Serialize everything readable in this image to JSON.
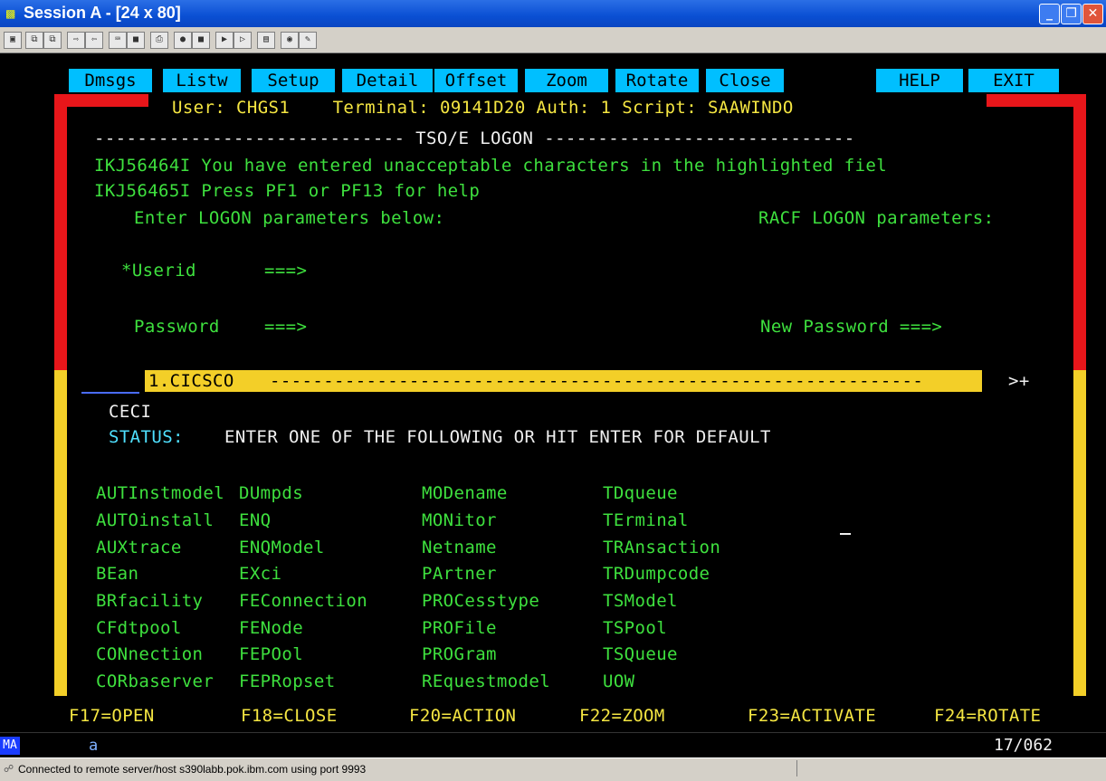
{
  "window": {
    "title": "Session A - [24 x 80]"
  },
  "menu": [
    "Dmsgs",
    "Listw",
    "Setup",
    "Detail",
    "Offset",
    "Zoom",
    "Rotate",
    "Close",
    "HELP",
    "EXIT"
  ],
  "header_line": "User: CHGS1    Terminal: 09141D20 Auth: 1 Script: SAAWINDO",
  "logon": {
    "divider": "----------------------------- TSO/E LOGON -----------------------------",
    "msg1": "IKJ56464I You have entered unacceptable characters in the highlighted fiel",
    "msg2": "IKJ56465I Press PF1 or PF13 for help",
    "enter_params": "Enter LOGON parameters below:",
    "racf_params": "RACF LOGON parameters:",
    "userid_label": "*Userid",
    "userid_arrow": "===>",
    "password_label": "Password",
    "password_arrow": "===>",
    "new_password": "New Password ===>"
  },
  "cics": {
    "title": "1.CICSCO",
    "dashes": "-------------------------------------------------------------",
    "more": ">+",
    "cmd": "CECI",
    "status_label": "STATUS:",
    "status_text": "ENTER ONE OF THE FOLLOWING OR HIT ENTER FOR DEFAULT",
    "col1": [
      "AUTInstmodel",
      "AUTOinstall",
      "AUXtrace",
      "BEan",
      "BRfacility",
      "CFdtpool",
      "CONnection",
      "CORbaserver"
    ],
    "col2": [
      "DUmpds",
      "ENQ",
      "ENQModel",
      "EXci",
      "FEConnection",
      "FENode",
      "FEPOol",
      "FEPRopset"
    ],
    "col3": [
      "MODename",
      "MONitor",
      "Netname",
      "PArtner",
      "PROCesstype",
      "PROFile",
      "PROGram",
      "REquestmodel"
    ],
    "col4": [
      "TDqueue",
      "TErminal",
      "TRAnsaction",
      "TRDumpcode",
      "TSModel",
      "TSPool",
      "TSQueue",
      "UOW"
    ]
  },
  "fkeys": [
    "F17=OPEN",
    "F18=CLOSE",
    "F20=ACTION",
    "F22=ZOOM",
    "F23=ACTIVATE",
    "F24=ROTATE"
  ],
  "oia": {
    "ma": "MA",
    "session": "a",
    "cursor": "17/062"
  },
  "status_bar": "Connected to remote server/host s390labb.pok.ibm.com using port 9993"
}
